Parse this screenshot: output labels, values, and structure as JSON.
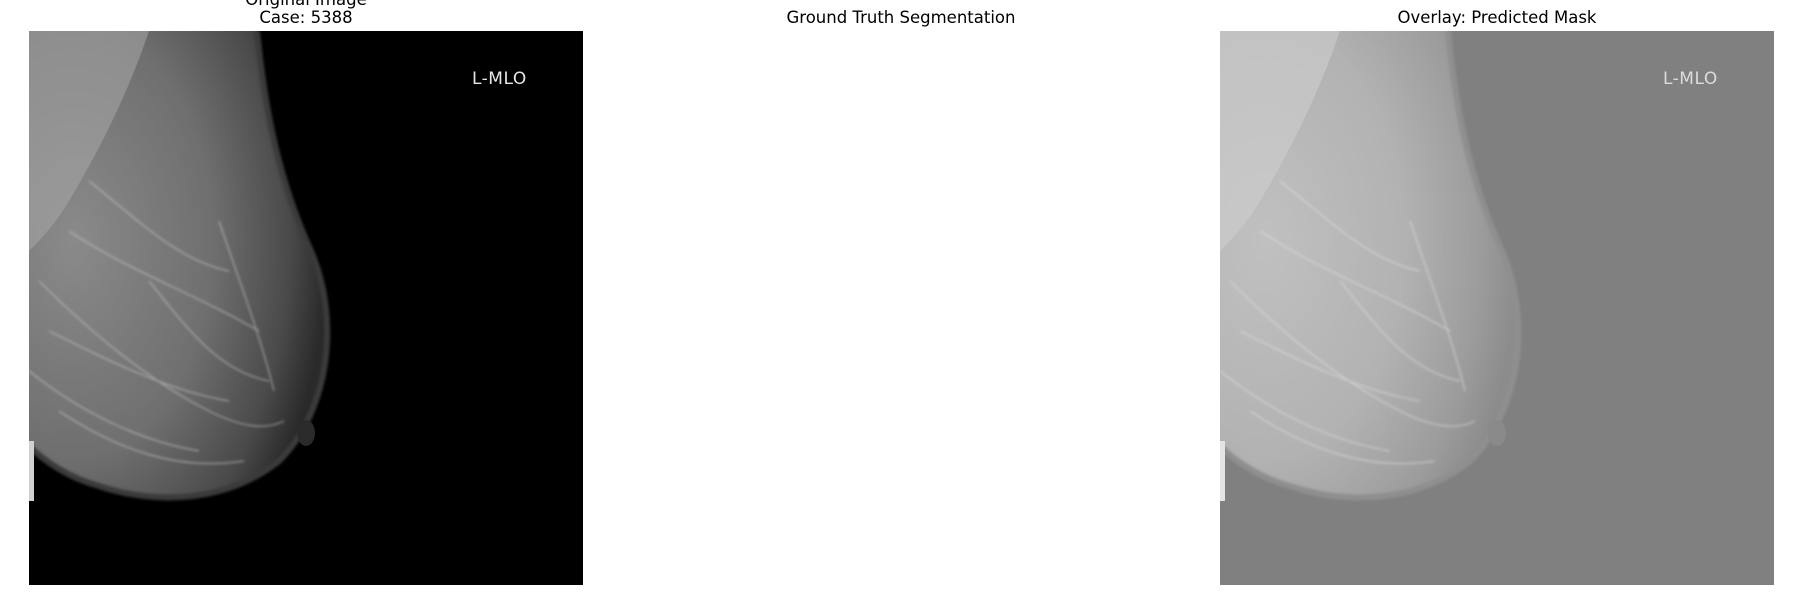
{
  "panels": [
    {
      "title_line1": "Original Image",
      "title_line2": "Case: 5388",
      "view_label": "L-MLO",
      "background": "#000000",
      "label_color": "#e6e6e6"
    },
    {
      "title": "Ground Truth Segmentation",
      "background": "#ffffff"
    },
    {
      "title": "Overlay: Predicted Mask",
      "view_label": "L-MLO",
      "background": "#808080",
      "label_color": "#dcdcdc"
    }
  ]
}
